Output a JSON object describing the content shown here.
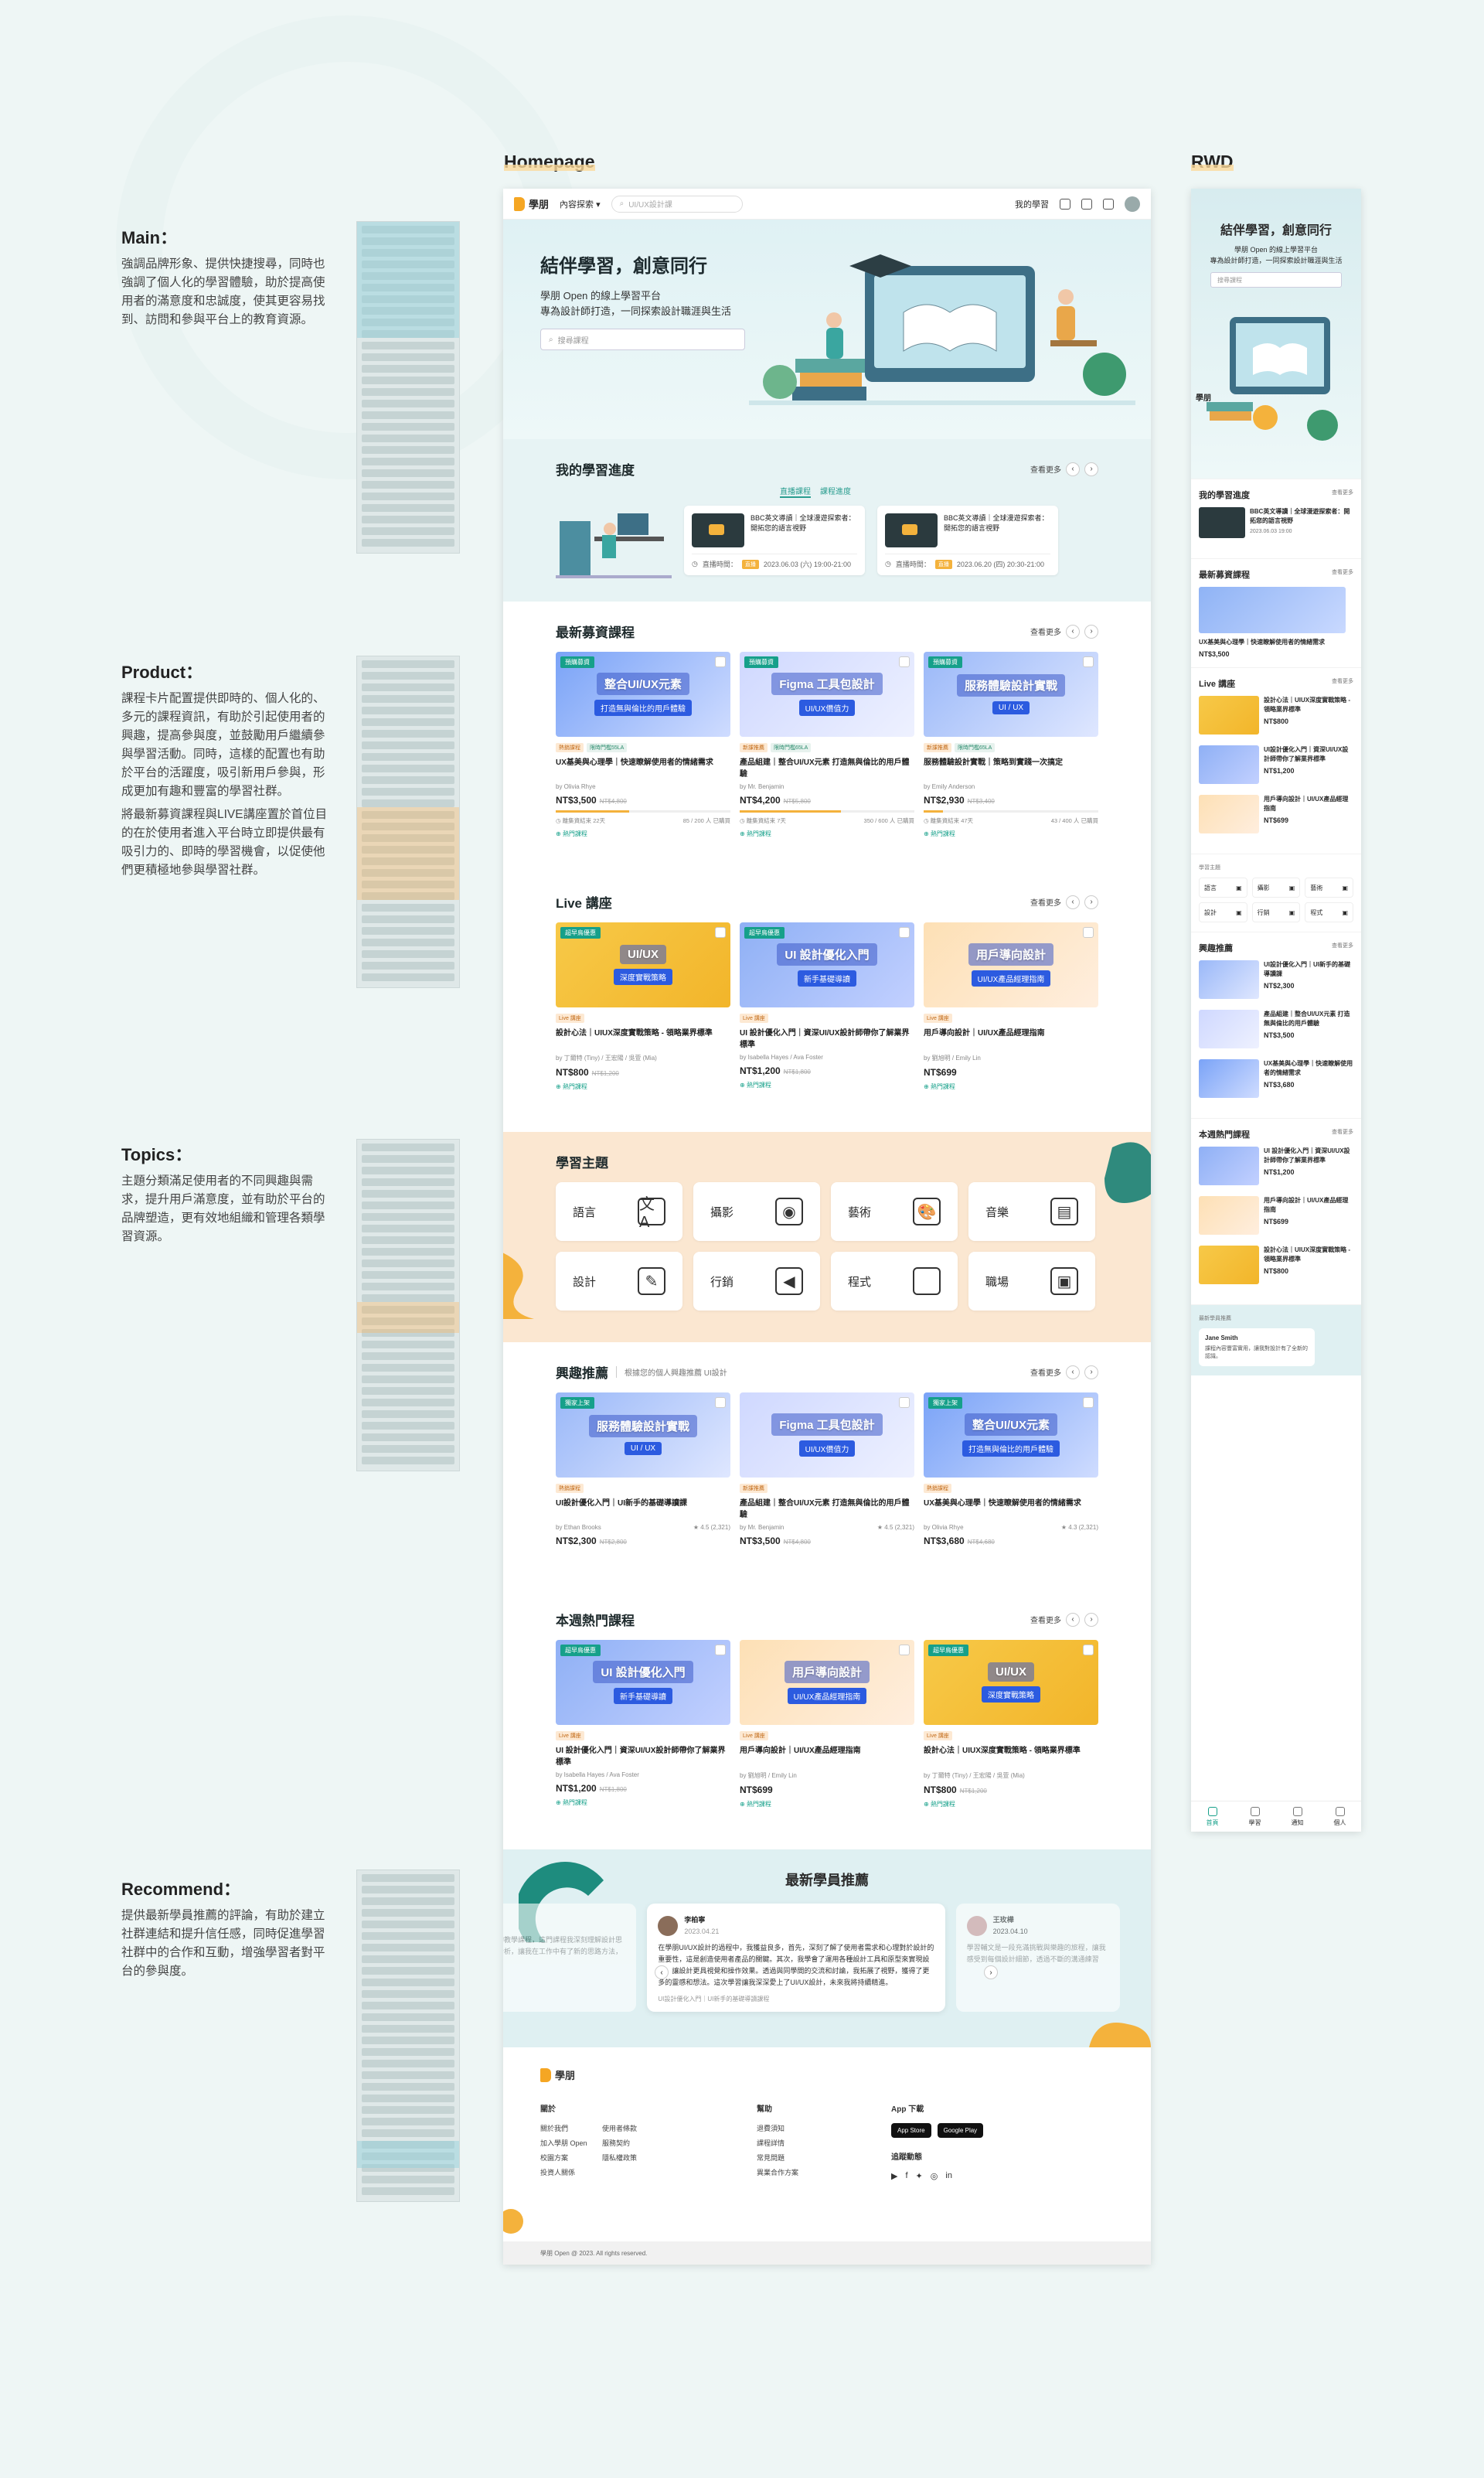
{
  "columns": {
    "homepage": "Homepage",
    "rwd": "RWD"
  },
  "annotations": [
    {
      "title": "Main：",
      "paras": [
        "強調品牌形象、提供快捷搜尋，同時也強調了個人化的學習體驗，助於提高使用者的滿意度和忠誠度，使其更容易找到、訪問和參與平台上的教育資源。"
      ]
    },
    {
      "title": "Product：",
      "paras": [
        "課程卡片配置提供即時的、個人化的、多元的課程資訊，有助於引起使用者的興趣，提高參與度，並鼓勵用戶繼續參與學習活動。同時，這樣的配置也有助於平台的活躍度，吸引新用戶參與，形成更加有趣和豐富的學習社群。",
        "將最新募資課程與LIVE講座置於首位目的在於使用者進入平台時立即提供最有吸引力的、即時的學習機會，以促使他們更積極地參與學習社群。"
      ]
    },
    {
      "title": "Topics：",
      "paras": [
        "主題分類滿足使用者的不同興趣與需求，提升用戶滿意度，並有助於平台的品牌塑造，更有效地組織和管理各類學習資源。"
      ]
    },
    {
      "title": "Recommend：",
      "paras": [
        "提供最新學員推薦的評論，有助於建立社群連結和提升信任感，同時促進學習社群中的合作和互動，增強學習者對平台的參與度。"
      ]
    }
  ],
  "nav": {
    "logo": "學朋",
    "menu": "內容探索",
    "search_placeholder": "UI/UX設計課",
    "my_learning": "我的學習"
  },
  "hero": {
    "title": "結伴學習，創意同行",
    "line1": "學朋 Open 的線上學習平台",
    "line2": "專為設計師打造，一同探索設計職涯與生活",
    "placeholder": "搜尋課程"
  },
  "progress": {
    "title": "我的學習進度",
    "tabs": [
      "直播課程",
      "課程進度"
    ],
    "more": "查看更多",
    "cards": [
      {
        "title": "BBC英文導讀｜全球漫遊探索者：開拓您的語言視野",
        "label": "直播時間：",
        "tag": "直播",
        "time": "2023.06.03 (六) 19:00-21:00"
      },
      {
        "title": "BBC英文導讀｜全球漫遊探索者：開拓您的語言視野",
        "label": "直播時間：",
        "tag": "直播",
        "time": "2023.06.20 (四) 20:30-21:00"
      }
    ]
  },
  "fundraising": {
    "title": "最新募資課程",
    "more": "查看更多",
    "cards": [
      {
        "badge": "預購募資",
        "img": "整合UI/UX元素",
        "img2": "打造無與倫比的用戶體驗",
        "tags": [
          "熱銷課程",
          "限時門檻55LA"
        ],
        "title": "UX基美與心理學｜快速瞭解使用者的情緒需求",
        "by": "by Olivia Rhye",
        "price": "NT$3,500",
        "old": "NT$4,800",
        "meta1": "◷ 離集資結束 22天",
        "meta2": "85 / 200 人 已購買",
        "link": "熱門課程",
        "fill": 42
      },
      {
        "badge": "預購募資",
        "img": "Figma 工具包設計",
        "img2": "UI/UX價值力",
        "tags": [
          "新課推薦",
          "限時門檻65LA"
        ],
        "title": "產品組建｜整合UI/UX元素 打造無與倫比的用戶體驗",
        "by": "by Mr. Benjamin",
        "price": "NT$4,200",
        "old": "NT$5,800",
        "meta1": "◷ 離集資結束 7天",
        "meta2": "350 / 600 人 已購買",
        "link": "熱門課程",
        "fill": 58
      },
      {
        "badge": "預購募資",
        "img": "服務體驗設計實戰",
        "img2": "UI / UX",
        "tags": [
          "新課推薦",
          "限時門檻65LA"
        ],
        "title": "服務體驗設計實戰｜策略到實踐一次搞定",
        "by": "by Emily Anderson",
        "price": "NT$2,930",
        "old": "NT$3,400",
        "meta1": "◷ 離集資結束 47天",
        "meta2": "43 / 400 人 已購買",
        "link": "熱門課程",
        "fill": 11
      }
    ]
  },
  "live": {
    "title": "Live 講座",
    "more": "查看更多",
    "cards": [
      {
        "badge": "超早鳥優惠",
        "img": "UI/UX",
        "img2": "深度實戰策略",
        "tag": "Live 講座",
        "title": "設計心法｜UIUX深度實戰策略 - 領略業界標準",
        "by": "by 丁爾特 (Tiny) / 王宏陽 / 吳萱 (Mia)",
        "price": "NT$800",
        "old": "NT$1,200",
        "link": "熱門課程"
      },
      {
        "badge": "超早鳥優惠",
        "img": "UI 設計優化入門",
        "img2": "新手基礎導讀",
        "tag": "Live 講座",
        "title": "UI 設計優化入門｜資深UI/UX設計師帶你了解業界標準",
        "by": "by Isabella Hayes / Ava Foster",
        "price": "NT$1,200",
        "old": "NT$1,800",
        "link": "熱門課程"
      },
      {
        "badge": "",
        "img": "用戶導向設計",
        "img2": "UI/UX產品經理指南",
        "tag": "Live 講座",
        "title": "用戶導向設計｜UI/UX產品經理指南",
        "by": "by 劉旭明 / Emily Lin",
        "price": "NT$699",
        "old": "",
        "link": "熱門課程"
      }
    ]
  },
  "topics": {
    "title": "學習主題",
    "items": [
      "語言",
      "攝影",
      "藝術",
      "音樂",
      "設計",
      "行銷",
      "程式",
      "職場"
    ]
  },
  "interest": {
    "title": "興趣推薦",
    "sub": "根據您的個人興趣推薦 UI設計",
    "more": "查看更多",
    "cards": [
      {
        "badge": "獨家上架",
        "img": "服務體驗設計實戰",
        "img2": "UI / UX",
        "tag": "熱銷課程",
        "title": "UI設計優化入門｜UI新手的基礎導讀課",
        "by": "by Ethan Brooks",
        "rate": "★ 4.5 (2,321)",
        "price": "NT$2,300",
        "old": "NT$2,800"
      },
      {
        "badge": "",
        "img": "Figma 工具包設計",
        "img2": "UI/UX價值力",
        "tag": "新課推薦",
        "title": "產品組建｜整合UI/UX元素 打造無與倫比的用戶體驗",
        "by": "by Mr. Benjamin",
        "rate": "★ 4.5 (2,321)",
        "price": "NT$3,500",
        "old": "NT$4,800"
      },
      {
        "badge": "獨家上架",
        "img": "整合UI/UX元素",
        "img2": "打造無與倫比的用戶體驗",
        "tag": "熱銷課程",
        "title": "UX基美與心理學｜快速瞭解使用者的情緒需求",
        "by": "by Olivia Rhye",
        "rate": "★ 4.3 (2,321)",
        "price": "NT$3,680",
        "old": "NT$4,680"
      }
    ]
  },
  "weekly": {
    "title": "本週熱門課程",
    "more": "查看更多",
    "cards": [
      {
        "badge": "超早鳥優惠",
        "img": "UI 設計優化入門",
        "img2": "新手基礎導讀",
        "tag": "Live 講座",
        "title": "UI 設計優化入門｜資深UI/UX設計師帶你了解業界標準",
        "by": "by Isabella Hayes / Ava Foster",
        "price": "NT$1,200",
        "old": "NT$1,800",
        "link": "熱門課程"
      },
      {
        "badge": "",
        "img": "用戶導向設計",
        "img2": "UI/UX產品經理指南",
        "tag": "Live 講座",
        "title": "用戶導向設計｜UI/UX產品經理指南",
        "by": "by 劉旭明 / Emily Lin",
        "price": "NT$699",
        "old": "",
        "link": "熱門課程"
      },
      {
        "badge": "超早鳥優惠",
        "img": "UI/UX",
        "img2": "深度實戰策略",
        "tag": "Live 講座",
        "title": "設計心法｜UIUX深度實戰策略 - 領略業界標準",
        "by": "by 丁爾特 (Tiny) / 王宏陽 / 吳萱 (Mia)",
        "price": "NT$800",
        "old": "NT$1,200",
        "link": "熱門課程"
      }
    ]
  },
  "reviews": {
    "title": "最新學員推薦",
    "main": {
      "name": "李柏寧",
      "date": "2023.04.21",
      "text": "在學朋UI/UX設計的過程中，我獲益良多，首先，深刻了解了使用者需求和心理對於設計的重要性，這是創造使用者產品的關鍵。其次，我學會了運用各種設計工具和原型來實現設計，讓設計更具視覺和操作效果。透過與同學間的交流和討論，我拓展了視野，獲得了更多的靈感和想法。這次學習讓我深深愛上了UI/UX設計，未來我將持續精進。",
      "course": "UI設計優化入門｜UI新手的基礎導讀課程"
    },
    "side_left": "完整的教學課程，這門課程我深刻理解設計思維與分析，讓我在工作中有了新的思路方法，每一",
    "side_right": {
      "name": "王玫樺",
      "date": "2023.04.10",
      "text": "學習輔文是一段充滿挑戰與樂趣的旅程，讓我感受到每個設計細節，透過不斷的溝通練習"
    }
  },
  "footer": {
    "logo": "學朋",
    "col1": {
      "title": "關於",
      "links": [
        "關於我們",
        "使用者條款",
        "加入學朋 Open",
        "服務契約",
        "校園方案",
        "隱私權政策",
        "投資人關係"
      ]
    },
    "col2": {
      "title": "幫助",
      "links": [
        "退費須知",
        "課程詳情",
        "常見問題",
        "異業合作方案"
      ]
    },
    "col3": {
      "title": "App 下載",
      "stores": [
        "App Store",
        "Google Play"
      ],
      "follow": "追蹤動態"
    },
    "copy": "學朋 Open @ 2023. All rights reserved."
  },
  "rwd": {
    "hero_title": "結伴學習，創意同行",
    "hero_line1": "學朋 Open 的線上學習平台",
    "hero_line2": "專為設計師打造，一同探索設計職涯與生活",
    "placeholder": "搜尋課程",
    "logo": "學朋",
    "progress_title": "我的學習進度",
    "progress_item": "BBC英文導讀｜全球漫遊探索者：開拓您的語言視野",
    "progress_time": "2023.06.03 19:00",
    "fund_title": "最新募資課程",
    "fund_item": "UX基美與心理學｜快速瞭解使用者的情緒需求",
    "fund_price": "NT$3,500",
    "live_title": "Live 講座",
    "live_items": [
      {
        "t": "設計心法｜UIUX深度實戰策略 - 領略業界標準",
        "p": "NT$800"
      },
      {
        "t": "UI設計優化入門｜資深UI/UX設計師帶你了解業界標準",
        "p": "NT$1,200"
      },
      {
        "t": "用戶導向設計｜UI/UX產品經理指南",
        "p": "NT$699"
      }
    ],
    "topics_title": "學習主題",
    "topics": [
      "語言",
      "攝影",
      "藝術",
      "設計",
      "行銷",
      "程式"
    ],
    "interest_title": "興趣推薦",
    "interest_items": [
      {
        "t": "UI設計優化入門｜UI新手的基礎導讀課",
        "p": "NT$2,300"
      },
      {
        "t": "產品組建｜整合UI/UX元素 打造無與倫比的用戶體驗",
        "p": "NT$3,500"
      },
      {
        "t": "UX基美與心理學｜快速瞭解使用者的情緒需求",
        "p": "NT$3,680"
      }
    ],
    "weekly_title": "本週熱門課程",
    "weekly_items": [
      {
        "t": "UI 設計優化入門｜資深UI/UX設計師帶你了解業界標準",
        "p": "NT$1,200"
      },
      {
        "t": "用戶導向設計｜UI/UX產品經理指南",
        "p": "NT$699"
      },
      {
        "t": "設計心法｜UIUX深度實戰策略 - 領略業界標準",
        "p": "NT$800"
      }
    ],
    "review_title": "最新學員推薦",
    "review_name": "Jane Smith",
    "review_text": "課程內容豐富實用，讓我對設計有了全新的認識。",
    "more": "查看更多",
    "tabs": [
      "首頁",
      "學習",
      "通知",
      "個人"
    ]
  },
  "colors": {
    "teal": "#16a08a",
    "orange": "#f4b23c",
    "peach": "#fbe7d1",
    "mint": "#dff0f2"
  }
}
